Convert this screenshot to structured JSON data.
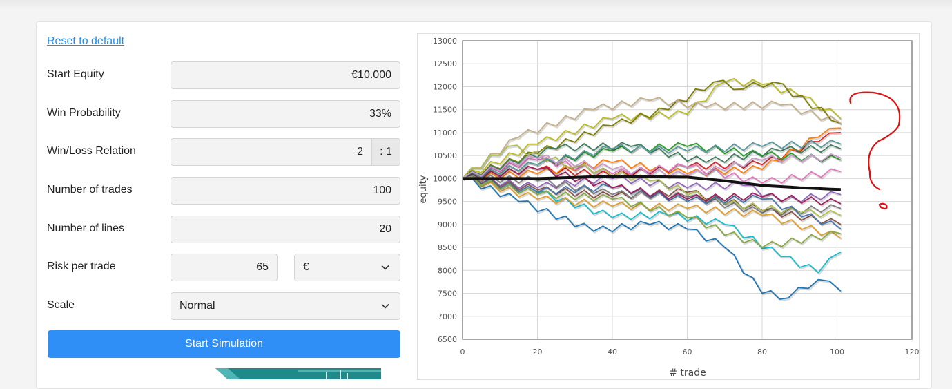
{
  "form": {
    "reset_label": "Reset to default",
    "start_equity_label": "Start Equity",
    "start_equity_value": "€10.000",
    "win_probability_label": "Win Probability",
    "win_probability_value": "33%",
    "win_loss_label": "Win/Loss Relation",
    "win_loss_value": "2",
    "win_loss_suffix": ": 1",
    "trades_label": "Number of trades",
    "trades_value": "100",
    "lines_label": "Number of lines",
    "lines_value": "20",
    "risk_label": "Risk per trade",
    "risk_value": "65",
    "risk_unit": "€",
    "scale_label": "Scale",
    "scale_value": "Normal",
    "start_button": "Start Simulation"
  },
  "chart_data": {
    "type": "line",
    "xlabel": "# trade",
    "ylabel": "equity",
    "xlim": [
      0,
      120
    ],
    "ylim": [
      6500,
      13000
    ],
    "x_ticks": [
      "0",
      "20",
      "40",
      "60",
      "80",
      "100",
      "120"
    ],
    "y_ticks": [
      "6500",
      "7000",
      "7500",
      "8000",
      "8500",
      "9000",
      "9500",
      "10000",
      "10500",
      "11000",
      "11500",
      "12000",
      "12500",
      "13000"
    ],
    "grid": true,
    "colors": [
      "#1f77b4",
      "#17becf",
      "#bcbd22",
      "#808000",
      "#c5b08a",
      "#d62728",
      "#ff7f0e",
      "#e377c2",
      "#9467bd",
      "#2ca02c",
      "#8c564b",
      "#7f7f7f",
      "#3f7f5f",
      "#b0c050",
      "#4a7ab0",
      "#e0a030",
      "#a02060",
      "#5a9aa0",
      "#cc99cc",
      "#88aa44"
    ],
    "series": [
      {
        "values": [
          [
            0,
            10000
          ],
          [
            15,
            9500
          ],
          [
            35,
            8850
          ],
          [
            50,
            9000
          ],
          [
            60,
            8900
          ],
          [
            70,
            8500
          ],
          [
            80,
            7500
          ],
          [
            87,
            7400
          ],
          [
            95,
            7800
          ],
          [
            101,
            7550
          ]
        ]
      },
      {
        "values": [
          [
            0,
            10000
          ],
          [
            20,
            9700
          ],
          [
            40,
            9150
          ],
          [
            55,
            9200
          ],
          [
            70,
            9000
          ],
          [
            85,
            8300
          ],
          [
            95,
            7950
          ],
          [
            101,
            8400
          ]
        ]
      },
      {
        "values": [
          [
            0,
            10000
          ],
          [
            20,
            10750
          ],
          [
            40,
            11300
          ],
          [
            60,
            11400
          ],
          [
            70,
            12100
          ],
          [
            80,
            12050
          ],
          [
            90,
            11800
          ],
          [
            101,
            11300
          ]
        ]
      },
      {
        "values": [
          [
            0,
            10000
          ],
          [
            20,
            10550
          ],
          [
            40,
            11150
          ],
          [
            55,
            11500
          ],
          [
            67,
            12100
          ],
          [
            75,
            11950
          ],
          [
            83,
            12100
          ],
          [
            101,
            11200
          ]
        ]
      },
      {
        "values": [
          [
            0,
            10000
          ],
          [
            15,
            10900
          ],
          [
            35,
            11500
          ],
          [
            50,
            11700
          ],
          [
            65,
            11550
          ],
          [
            85,
            11600
          ],
          [
            101,
            11200
          ]
        ]
      },
      {
        "values": [
          [
            0,
            10000
          ],
          [
            20,
            10200
          ],
          [
            40,
            10050
          ],
          [
            60,
            10250
          ],
          [
            80,
            10300
          ],
          [
            95,
            10800
          ],
          [
            101,
            11000
          ]
        ]
      },
      {
        "values": [
          [
            0,
            10000
          ],
          [
            20,
            10100
          ],
          [
            40,
            10350
          ],
          [
            60,
            10100
          ],
          [
            80,
            10200
          ],
          [
            95,
            10900
          ],
          [
            101,
            11100
          ]
        ]
      },
      {
        "values": [
          [
            0,
            10000
          ],
          [
            20,
            10400
          ],
          [
            40,
            10100
          ],
          [
            60,
            10250
          ],
          [
            80,
            9900
          ],
          [
            101,
            10150
          ]
        ]
      },
      {
        "values": [
          [
            0,
            10000
          ],
          [
            20,
            9800
          ],
          [
            40,
            10000
          ],
          [
            60,
            9800
          ],
          [
            75,
            9850
          ],
          [
            85,
            9500
          ],
          [
            101,
            9650
          ]
        ]
      },
      {
        "values": [
          [
            0,
            10000
          ],
          [
            20,
            10300
          ],
          [
            40,
            10600
          ],
          [
            60,
            10700
          ],
          [
            80,
            10500
          ],
          [
            101,
            10400
          ]
        ]
      },
      {
        "values": [
          [
            0,
            10000
          ],
          [
            20,
            9750
          ],
          [
            40,
            9600
          ],
          [
            60,
            9700
          ],
          [
            80,
            9300
          ],
          [
            101,
            9000
          ]
        ]
      },
      {
        "values": [
          [
            0,
            10000
          ],
          [
            20,
            9950
          ],
          [
            40,
            9650
          ],
          [
            60,
            9600
          ],
          [
            80,
            9250
          ],
          [
            101,
            9350
          ]
        ]
      },
      {
        "values": [
          [
            0,
            10000
          ],
          [
            25,
            10650
          ],
          [
            45,
            10700
          ],
          [
            65,
            10350
          ],
          [
            85,
            10600
          ],
          [
            101,
            10650
          ]
        ]
      },
      {
        "values": [
          [
            0,
            10000
          ],
          [
            12,
            10700
          ],
          [
            30,
            10250
          ],
          [
            50,
            9950
          ],
          [
            70,
            9450
          ],
          [
            90,
            9250
          ],
          [
            101,
            9200
          ]
        ]
      },
      {
        "values": [
          [
            0,
            10000
          ],
          [
            20,
            9700
          ],
          [
            40,
            9800
          ],
          [
            60,
            9500
          ],
          [
            80,
            9550
          ],
          [
            101,
            8900
          ]
        ]
      },
      {
        "values": [
          [
            0,
            10000
          ],
          [
            20,
            9550
          ],
          [
            40,
            9400
          ],
          [
            60,
            9350
          ],
          [
            80,
            9200
          ],
          [
            101,
            8700
          ]
        ]
      },
      {
        "values": [
          [
            0,
            10000
          ],
          [
            20,
            10200
          ],
          [
            40,
            9800
          ],
          [
            60,
            9550
          ],
          [
            80,
            9600
          ],
          [
            101,
            9450
          ]
        ]
      },
      {
        "values": [
          [
            0,
            10000
          ],
          [
            20,
            10300
          ],
          [
            40,
            10650
          ],
          [
            60,
            10600
          ],
          [
            80,
            10700
          ],
          [
            101,
            10750
          ]
        ]
      },
      {
        "values": [
          [
            0,
            10000
          ],
          [
            20,
            10450
          ],
          [
            40,
            10200
          ],
          [
            60,
            10050
          ],
          [
            80,
            10400
          ],
          [
            101,
            10450
          ]
        ]
      },
      {
        "values": [
          [
            0,
            10000
          ],
          [
            20,
            9650
          ],
          [
            40,
            9550
          ],
          [
            60,
            9150
          ],
          [
            80,
            8500
          ],
          [
            101,
            8800
          ]
        ]
      },
      {
        "name": "",
        "values": [
          [
            0,
            10000
          ],
          [
            20,
            10000
          ],
          [
            40,
            10050
          ],
          [
            60,
            10030
          ],
          [
            70,
            9950
          ],
          [
            80,
            9850
          ],
          [
            90,
            9800
          ],
          [
            101,
            9760
          ]
        ]
      }
    ]
  }
}
